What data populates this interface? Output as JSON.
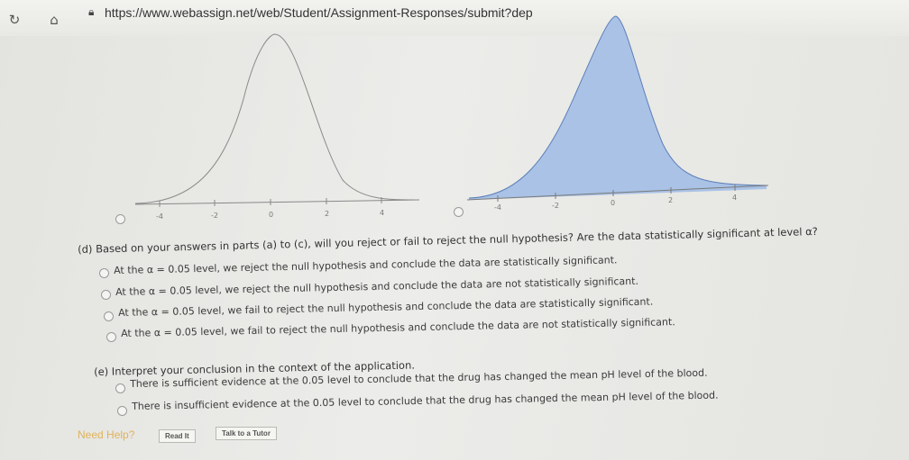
{
  "browser": {
    "url": "https://www.webassign.net/web/Student/Assignment-Responses/submit?dep",
    "reload_icon": "reload-icon",
    "home_icon": "home-icon",
    "lock_icon": "lock-icon"
  },
  "graphs": [
    {
      "ticks": [
        "-4",
        "-2",
        "0",
        "2",
        "4"
      ],
      "shaded": false
    },
    {
      "ticks": [
        "-4",
        "-2",
        "0",
        "2",
        "4"
      ],
      "shaded": true
    }
  ],
  "part_d": {
    "question": "(d) Based on your answers in parts (a) to (c), will you reject or fail to reject the null hypothesis? Are the data statistically significant at level α?",
    "options": [
      "At the α = 0.05 level, we reject the null hypothesis and conclude the data are statistically significant.",
      "At the α = 0.05 level, we reject the null hypothesis and conclude the data are not statistically significant.",
      "At the α = 0.05 level, we fail to reject the null hypothesis and conclude the data are statistically significant.",
      "At the α = 0.05 level, we fail to reject the null hypothesis and conclude the data are not statistically significant."
    ]
  },
  "part_e": {
    "question": "(e) Interpret your conclusion in the context of the application.",
    "options": [
      "There is sufficient evidence at the 0.05 level to conclude that the drug has changed the mean pH level of the blood.",
      "There is insufficient evidence at the 0.05 level to conclude that the drug has changed the mean pH level of the blood."
    ]
  },
  "help": {
    "label": "Need Help?",
    "read_it": "Read It",
    "talk_tutor": "Talk to a Tutor"
  },
  "colors": {
    "curve_fill": "#a9c2e6",
    "curve_stroke": "#5c7fb8",
    "accent": "#e0b35a"
  }
}
